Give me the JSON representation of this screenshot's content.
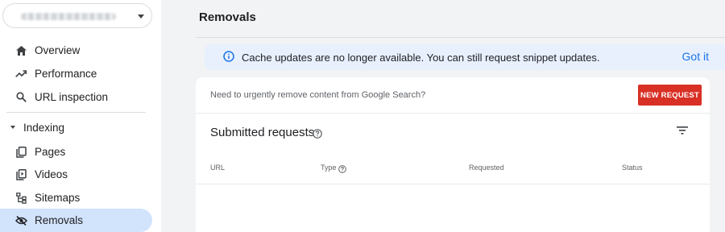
{
  "sidebar": {
    "property_selector": {
      "icon": "chevron-down-icon"
    },
    "items": [
      {
        "label": "Overview",
        "icon": "home-icon"
      },
      {
        "label": "Performance",
        "icon": "trending-up-icon"
      },
      {
        "label": "URL inspection",
        "icon": "search-icon"
      }
    ],
    "section": {
      "label": "Indexing",
      "icon": "caret-down-icon"
    },
    "section_items": [
      {
        "label": "Pages",
        "icon": "pages-icon"
      },
      {
        "label": "Videos",
        "icon": "video-icon"
      },
      {
        "label": "Sitemaps",
        "icon": "sitemap-icon"
      },
      {
        "label": "Removals",
        "icon": "visibility-off-icon",
        "active": true
      }
    ]
  },
  "main": {
    "title": "Removals",
    "banner": {
      "icon": "info-icon",
      "text": "Cache updates are no longer available. You can still request snippet updates.",
      "action": "Got it"
    },
    "card": {
      "prompt": "Need to urgently remove content from Google Search?",
      "new_request_label": "NEW REQUEST",
      "section_title": "Submitted requests",
      "columns": [
        "URL",
        "Type",
        "Requested",
        "Status"
      ]
    }
  },
  "colors": {
    "accent": "#1a73e8",
    "banner_bg": "#e8f0fe",
    "active_nav_bg": "#d2e3fc",
    "danger": "#d93025"
  }
}
